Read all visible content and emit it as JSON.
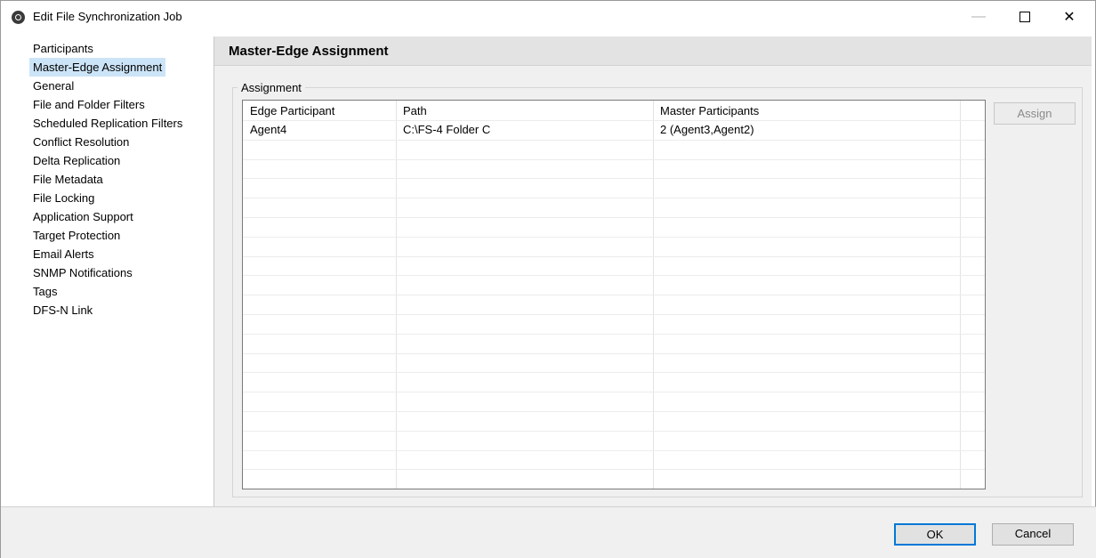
{
  "window": {
    "title": "Edit File Synchronization Job"
  },
  "sidebar": {
    "items": [
      {
        "label": "Participants",
        "selected": false
      },
      {
        "label": "Master-Edge Assignment",
        "selected": true
      },
      {
        "label": "General",
        "selected": false
      },
      {
        "label": "File and Folder Filters",
        "selected": false
      },
      {
        "label": "Scheduled Replication Filters",
        "selected": false
      },
      {
        "label": "Conflict Resolution",
        "selected": false
      },
      {
        "label": "Delta Replication",
        "selected": false
      },
      {
        "label": "File Metadata",
        "selected": false
      },
      {
        "label": "File Locking",
        "selected": false
      },
      {
        "label": "Application Support",
        "selected": false
      },
      {
        "label": "Target Protection",
        "selected": false
      },
      {
        "label": "Email Alerts",
        "selected": false
      },
      {
        "label": "SNMP Notifications",
        "selected": false
      },
      {
        "label": "Tags",
        "selected": false
      },
      {
        "label": "DFS-N Link",
        "selected": false
      }
    ]
  },
  "main": {
    "title": "Master-Edge Assignment",
    "group_label": "Assignment",
    "table": {
      "columns": [
        "Edge Participant",
        "Path",
        "Master Participants"
      ],
      "rows": [
        [
          "Agent4",
          "C:\\FS-4 Folder C",
          "2 (Agent3,Agent2)"
        ]
      ]
    },
    "assign_label": "Assign"
  },
  "footer": {
    "ok_label": "OK",
    "cancel_label": "Cancel"
  },
  "colors": {
    "selection": "#cce4f7",
    "default_button_border": "#0078d7",
    "header_bar": "#e3e3e3"
  }
}
